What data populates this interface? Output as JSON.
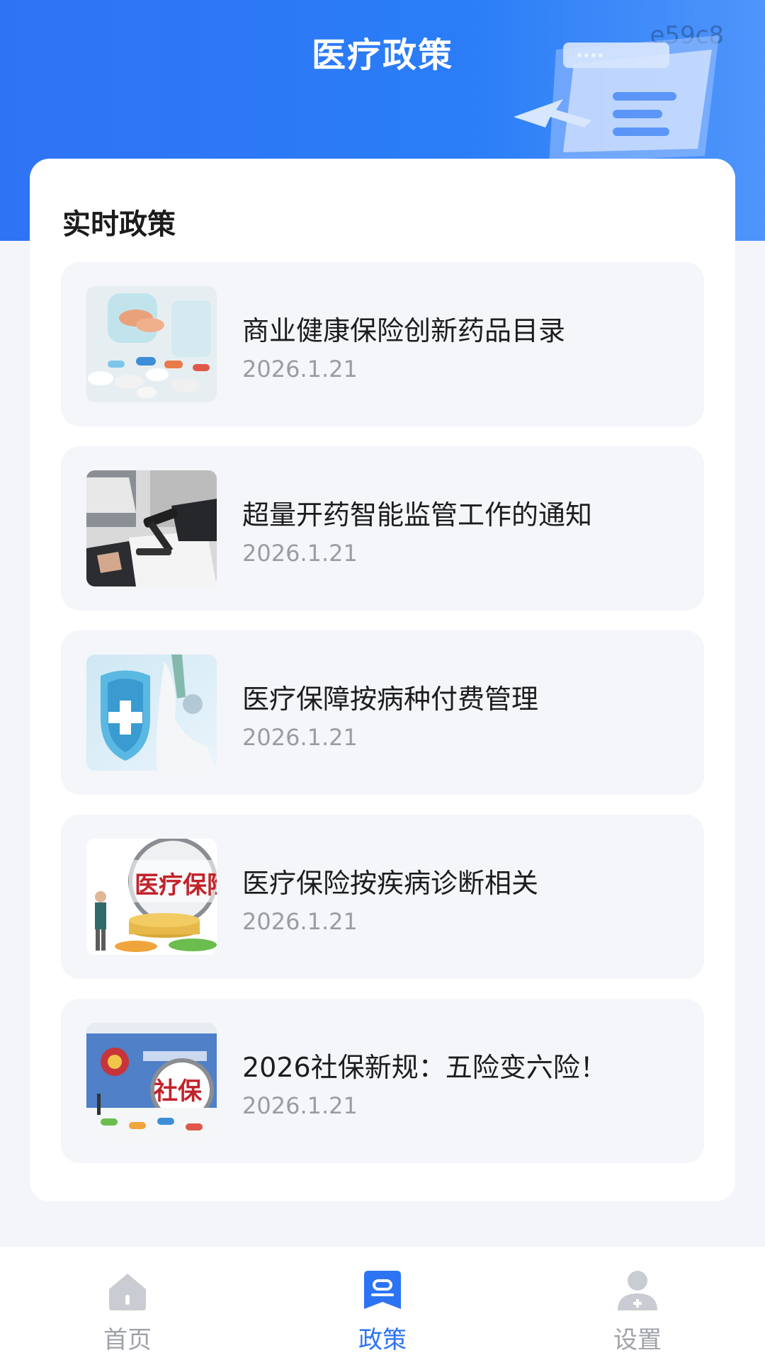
{
  "header": {
    "title": "医疗政策",
    "watermark": "e59c8"
  },
  "section": {
    "title": "实时政策"
  },
  "policies": [
    {
      "title": "商业健康保险创新药品目录",
      "date": "2026.1.21",
      "thumb": "pills-image"
    },
    {
      "title": "超量开药智能监管工作的通知",
      "date": "2026.1.21",
      "thumb": "gavel-document-image"
    },
    {
      "title": "医疗保障按病种付费管理",
      "date": "2026.1.21",
      "thumb": "medical-shield-image"
    },
    {
      "title": "医疗保险按疾病诊断相关",
      "date": "2026.1.21",
      "thumb": "medical-insurance-coins-image"
    },
    {
      "title": "2026社保新规：五险变六险！",
      "date": "2026.1.21",
      "thumb": "social-security-image"
    }
  ],
  "tabbar": {
    "tabs": [
      {
        "label": "首页",
        "icon": "home-icon",
        "active": false
      },
      {
        "label": "政策",
        "icon": "policy-icon",
        "active": true
      },
      {
        "label": "设置",
        "icon": "user-settings-icon",
        "active": false
      }
    ]
  },
  "colors": {
    "primary": "#2d74f4",
    "inactive": "#9fa2a8",
    "background": "#f3f5fa"
  },
  "image_text": {
    "thumb4_sign": "医疗保险",
    "thumb5_sign": "社保"
  }
}
